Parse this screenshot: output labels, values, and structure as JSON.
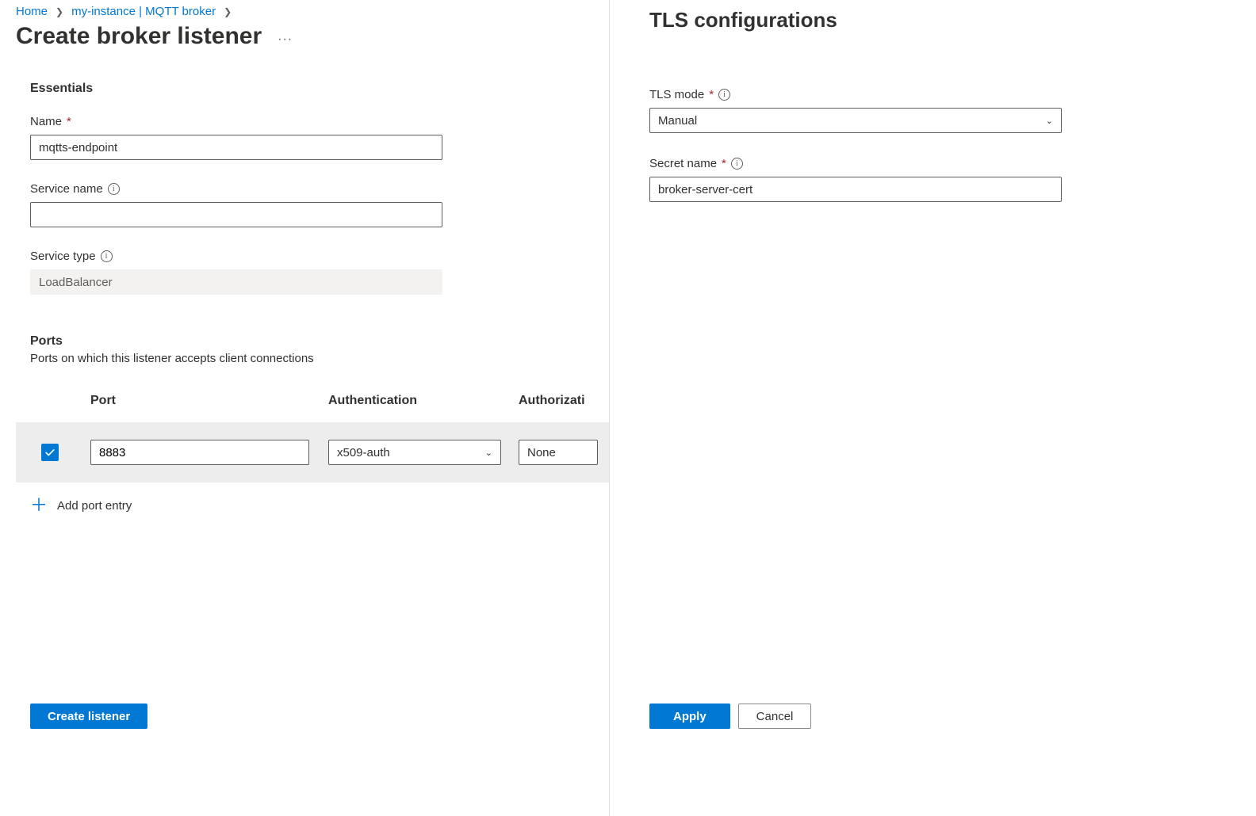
{
  "breadcrumb": {
    "home": "Home",
    "instance": "my-instance | MQTT broker"
  },
  "page": {
    "title": "Create broker listener",
    "essentials_heading": "Essentials",
    "name_label": "Name",
    "name_value": "mqtts-endpoint",
    "service_name_label": "Service name",
    "service_name_value": "",
    "service_type_label": "Service type",
    "service_type_value": "LoadBalancer"
  },
  "ports": {
    "heading": "Ports",
    "subtext": "Ports on which this listener accepts client connections",
    "col_port": "Port",
    "col_auth": "Authentication",
    "col_az": "Authorizati",
    "row": {
      "port": "8883",
      "auth": "x509-auth",
      "authorization": "None"
    },
    "add_entry": "Add port entry"
  },
  "footer": {
    "create": "Create listener"
  },
  "side": {
    "title": "TLS configurations",
    "tls_mode_label": "TLS mode",
    "tls_mode_value": "Manual",
    "secret_name_label": "Secret name",
    "secret_name_value": "broker-server-cert",
    "apply": "Apply",
    "cancel": "Cancel"
  }
}
